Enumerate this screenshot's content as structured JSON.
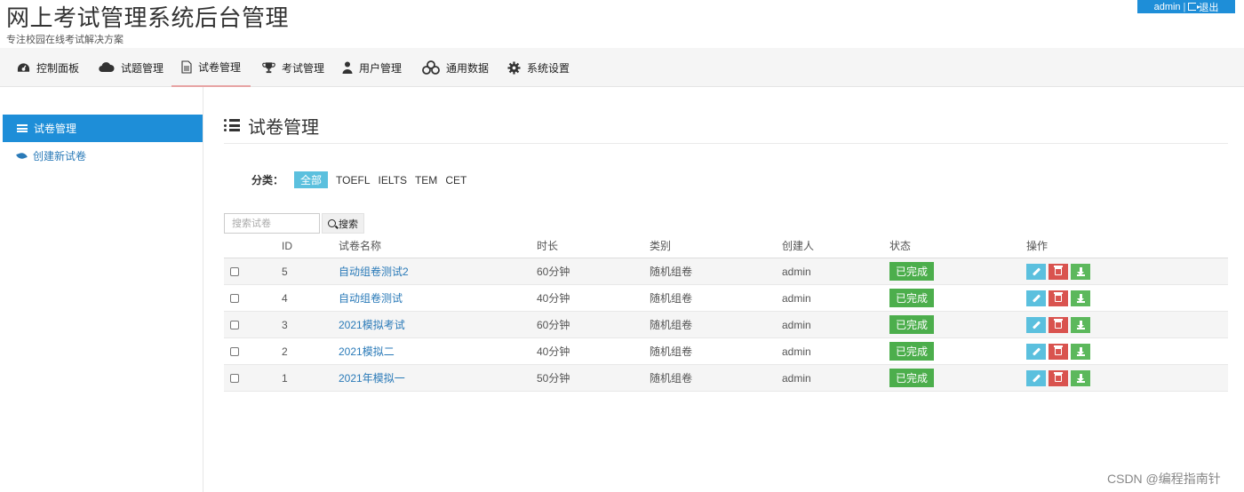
{
  "header": {
    "title": "网上考试管理系统后台管理",
    "subtitle": "专注校园在线考试解决方案",
    "user": "admin",
    "separator": "|",
    "logout_label": "退出"
  },
  "nav": {
    "items": [
      {
        "label": "控制面板",
        "icon": "dashboard-icon"
      },
      {
        "label": "试题管理",
        "icon": "cloud-icon"
      },
      {
        "label": "试卷管理",
        "icon": "file-icon"
      },
      {
        "label": "考试管理",
        "icon": "trophy-icon"
      },
      {
        "label": "用户管理",
        "icon": "user-icon"
      },
      {
        "label": "通用数据",
        "icon": "cubes-icon"
      },
      {
        "label": "系统设置",
        "icon": "gear-icon"
      }
    ],
    "active_index": 2
  },
  "sidebar": {
    "items": [
      {
        "label": "试卷管理",
        "icon": "list-icon",
        "active": true
      },
      {
        "label": "创建新试卷",
        "icon": "leaf-icon",
        "active": false
      }
    ]
  },
  "main": {
    "title": "试卷管理",
    "filter": {
      "label": "分类：",
      "options": [
        "全部",
        "TOEFL",
        "IELTS",
        "TEM",
        "CET"
      ],
      "active_index": 0
    },
    "search": {
      "placeholder": "搜索试卷",
      "button_label": "搜索"
    },
    "table": {
      "headers": {
        "id": "ID",
        "name": "试卷名称",
        "duration": "时长",
        "type": "类别",
        "creator": "创建人",
        "status": "状态",
        "ops": "操作"
      },
      "rows": [
        {
          "id": "5",
          "name": "自动组卷测试2",
          "duration": "60分钟",
          "type": "随机组卷",
          "creator": "admin",
          "status": "已完成"
        },
        {
          "id": "4",
          "name": "自动组卷测试",
          "duration": "40分钟",
          "type": "随机组卷",
          "creator": "admin",
          "status": "已完成"
        },
        {
          "id": "3",
          "name": "2021模拟考试",
          "duration": "60分钟",
          "type": "随机组卷",
          "creator": "admin",
          "status": "已完成"
        },
        {
          "id": "2",
          "name": "2021模拟二",
          "duration": "40分钟",
          "type": "随机组卷",
          "creator": "admin",
          "status": "已完成"
        },
        {
          "id": "1",
          "name": "2021年模拟一",
          "duration": "50分钟",
          "type": "随机组卷",
          "creator": "admin",
          "status": "已完成"
        }
      ]
    }
  },
  "watermark": "CSDN @编程指南针",
  "colors": {
    "accent": "#1e8ed8",
    "success": "#4cae4c",
    "info": "#5bc0de",
    "danger": "#d9534f"
  }
}
